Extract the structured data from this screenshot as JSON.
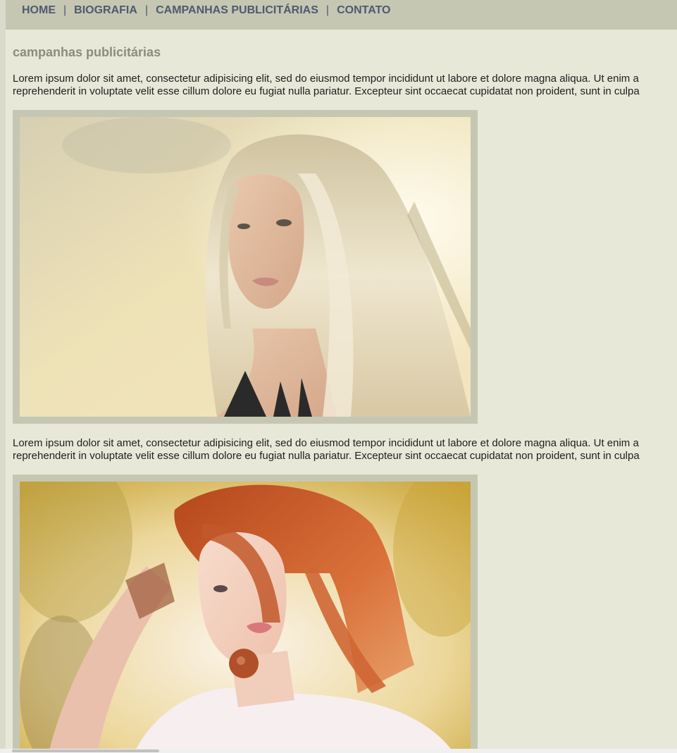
{
  "nav": {
    "items": [
      "HOME",
      "BIOGRAFIA",
      "CAMPANHAS PUBLICITÁRIAS",
      "CONTATO"
    ],
    "separator": "|"
  },
  "main": {
    "title": "campanhas publicitárias",
    "paragraphs": [
      {
        "line1": "Lorem ipsum dolor sit amet, consectetur adipisicing elit, sed do eiusmod tempor incididunt ut labore et dolore magna aliqua. Ut enim a",
        "line2": "reprehenderit in voluptate velit esse cillum dolore eu fugiat nulla pariatur. Excepteur sint occaecat cupidatat non proident, sunt in culpa"
      },
      {
        "line1": "Lorem ipsum dolor sit amet, consectetur adipisicing elit, sed do eiusmod tempor incididunt ut labore et dolore magna aliqua. Ut enim a",
        "line2": "reprehenderit in voluptate velit esse cillum dolore eu fugiat nulla pariatur. Excepteur sint occaecat cupidatat non proident, sunt in culpa"
      }
    ]
  },
  "colors": {
    "page_background": "#e8e8d9",
    "nav_background": "#c5c7b3",
    "nav_text": "#4e5a6e",
    "title_text": "#8c8c7c",
    "frame": "#c5c7b3"
  }
}
